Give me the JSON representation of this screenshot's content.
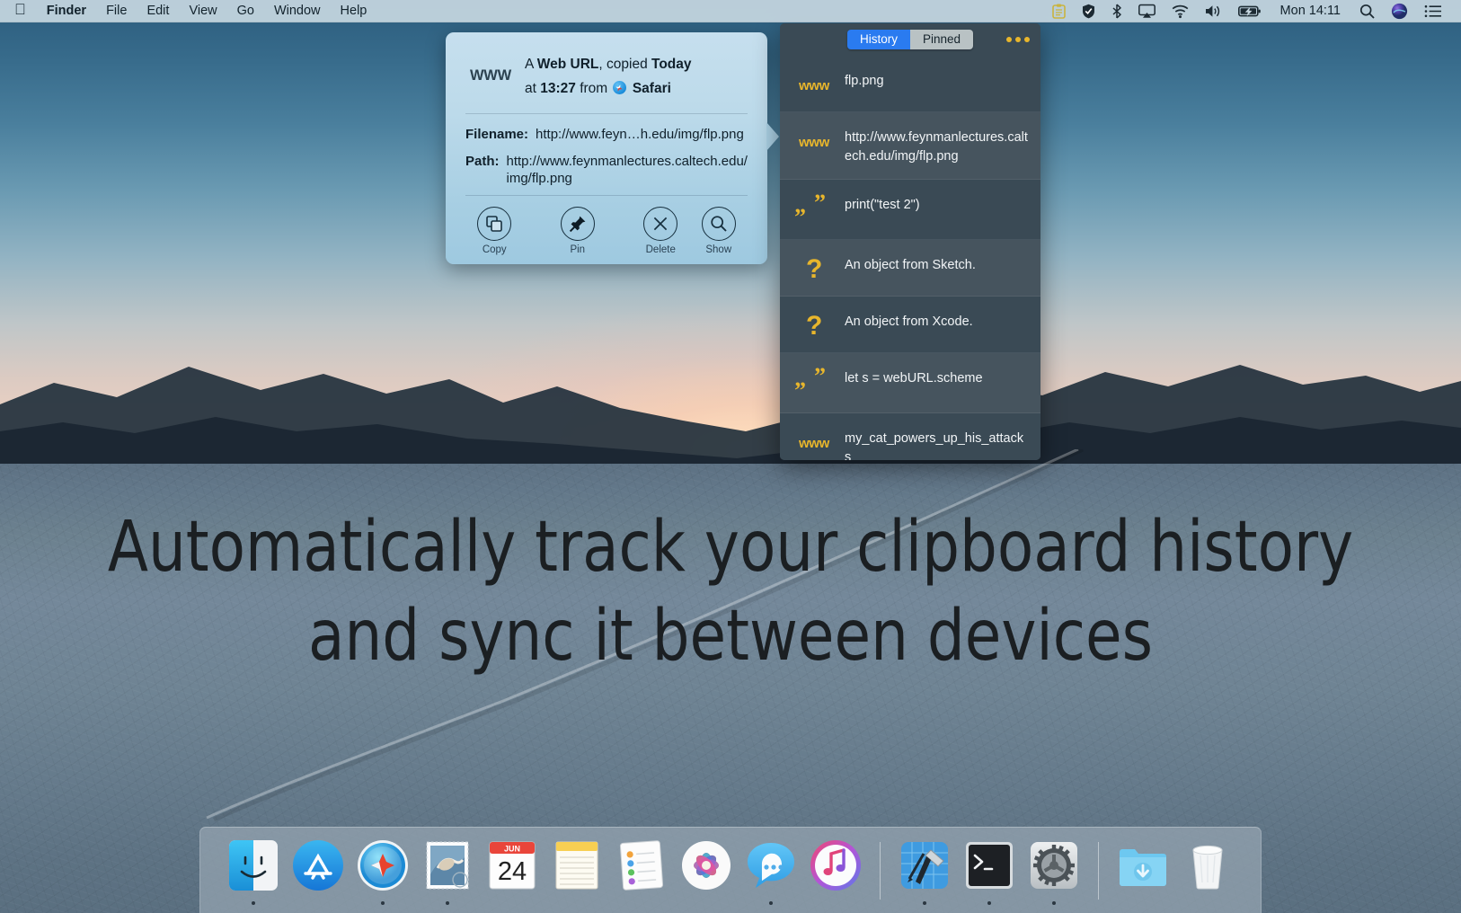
{
  "menubar": {
    "apple_icon": "apple-logo",
    "items": [
      {
        "label": "Finder",
        "bold": true
      },
      {
        "label": "File",
        "bold": false
      },
      {
        "label": "Edit",
        "bold": false
      },
      {
        "label": "View",
        "bold": false
      },
      {
        "label": "Go",
        "bold": false
      },
      {
        "label": "Window",
        "bold": false
      },
      {
        "label": "Help",
        "bold": false
      }
    ],
    "status_icons": [
      "clipboard-icon",
      "shield-icon",
      "bluetooth-icon",
      "airplay-icon",
      "wifi-icon",
      "volume-icon",
      "battery-charging-icon"
    ],
    "clock": "Mon 14:11",
    "trailing_icons": [
      "search-icon",
      "siri-icon",
      "control-center-icon"
    ]
  },
  "detail_popup": {
    "kind_icon": "WWW",
    "header_line1_prefix": "A",
    "header_line1_kind": "Web URL",
    "header_line1_mid": ", copied",
    "header_line1_when": "Today",
    "header_line2_prefix": "at",
    "header_line2_time": "13:27",
    "header_line2_mid": "from",
    "header_line2_app": "Safari",
    "fields": [
      {
        "label": "Filename:",
        "value": "http://www.feyn…h.edu/img/flp.png"
      },
      {
        "label": "Path:",
        "value": "http://www.feynmanlectures.caltech.edu/img/flp.png"
      }
    ],
    "actions": [
      {
        "caption": "Copy",
        "icon": "copy-icon"
      },
      {
        "caption": "Pin",
        "icon": "pin-icon"
      },
      {
        "caption": "Delete",
        "icon": "delete-x-icon"
      },
      {
        "caption": "Show",
        "icon": "magnifier-icon"
      }
    ]
  },
  "history_window": {
    "tabs": [
      {
        "label": "History",
        "active": true
      },
      {
        "label": "Pinned",
        "active": false
      }
    ],
    "more_button": "ellipsis-icon",
    "rows": [
      {
        "icon": "www",
        "text": "flp.png"
      },
      {
        "icon": "www",
        "text": "http://www.feynmanlectures.caltech.edu/img/flp.png"
      },
      {
        "icon": "quote",
        "text": "print(\"test 2\")"
      },
      {
        "icon": "question",
        "text": "An object from Sketch."
      },
      {
        "icon": "question",
        "text": "An object from Xcode."
      },
      {
        "icon": "quote",
        "text": "let s = webURL.scheme"
      },
      {
        "icon": "www",
        "text": "my_cat_powers_up_his_attacks"
      }
    ]
  },
  "headline": {
    "line1": "Automatically track your clipboard history",
    "line2": "and sync it between devices"
  },
  "dock": {
    "items": [
      {
        "name": "finder",
        "running": true
      },
      {
        "name": "app-store",
        "running": false
      },
      {
        "name": "safari",
        "running": true
      },
      {
        "name": "mail",
        "running": true
      },
      {
        "name": "calendar",
        "running": false,
        "month": "JUN",
        "day": "24"
      },
      {
        "name": "notes",
        "running": false
      },
      {
        "name": "reminders",
        "running": false
      },
      {
        "name": "photos",
        "running": false
      },
      {
        "name": "messages",
        "running": true
      },
      {
        "name": "itunes",
        "running": false
      },
      {
        "name": "separator",
        "running": false
      },
      {
        "name": "xcode",
        "running": true
      },
      {
        "name": "terminal",
        "running": true
      },
      {
        "name": "system-preferences",
        "running": true
      },
      {
        "name": "separator",
        "running": false
      },
      {
        "name": "downloads-folder",
        "running": false
      },
      {
        "name": "trash",
        "running": false
      }
    ]
  },
  "colors": {
    "accent_blue": "#2a7bf0",
    "list_gold": "#e8b62c",
    "popup_blue": "#bcdaea",
    "window_dark": "#3a4a55"
  }
}
